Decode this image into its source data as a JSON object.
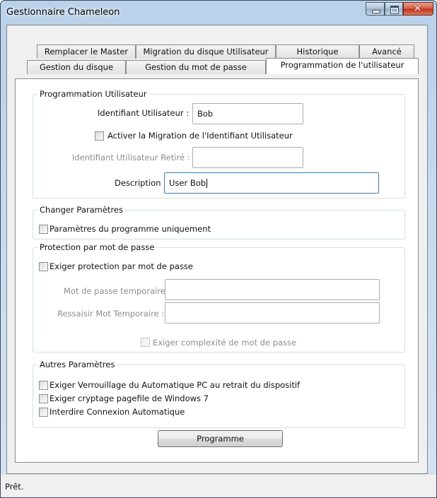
{
  "window": {
    "title": "Gestionnaire Chameleon"
  },
  "tabs": {
    "row1": [
      "Remplacer le Master",
      "Migration du disque Utilisateur",
      "Historique",
      "Avancé"
    ],
    "row2": [
      "Gestion du disque",
      "Gestion du mot de passe",
      "Programmation de l'utilisateur"
    ],
    "active": "Programmation de l'utilisateur"
  },
  "user_group": {
    "title": "Programmation Utilisateur",
    "user_id_label": "Identifiant Utilisateur :",
    "user_id_value": "Bob",
    "migrate_label": "Activer la Migration de l'Identifiant Utilisateur",
    "migrate_checked": false,
    "retired_label": "Identifiant Utilisateur Retiré :",
    "retired_value": "",
    "description_label": "Description :",
    "description_value": "User Bob"
  },
  "change_group": {
    "title": "Changer Paramètres",
    "program_only_label": "Paramètres du programme uniquement",
    "program_only_checked": false
  },
  "password_group": {
    "title": "Protection par mot de passe",
    "require_label": "Exiger protection par mot de passe",
    "require_checked": false,
    "temp_label": "Mot de passe temporaire :",
    "temp_value": "",
    "retype_label": "Ressaisir Mot Temporaire :",
    "retype_value": "",
    "complexity_label": "Exiger complexité de mot de passe",
    "complexity_checked": false
  },
  "other_group": {
    "title": "Autres Paramètres",
    "lock_label": "Exiger Verrouillage du Automatique PC au retrait du dispositif",
    "lock_checked": false,
    "pagefile_label": "Exiger cryptage pagefile de Windows 7",
    "pagefile_checked": false,
    "autologin_label": "Interdire Connexion Automatique",
    "autologin_checked": false
  },
  "program_button": "Programme",
  "status": "Prêt.",
  "colors": {
    "titlebar": "#b9d1ea",
    "close_button": "#c1301a",
    "focus_border": "#3d7bad"
  }
}
